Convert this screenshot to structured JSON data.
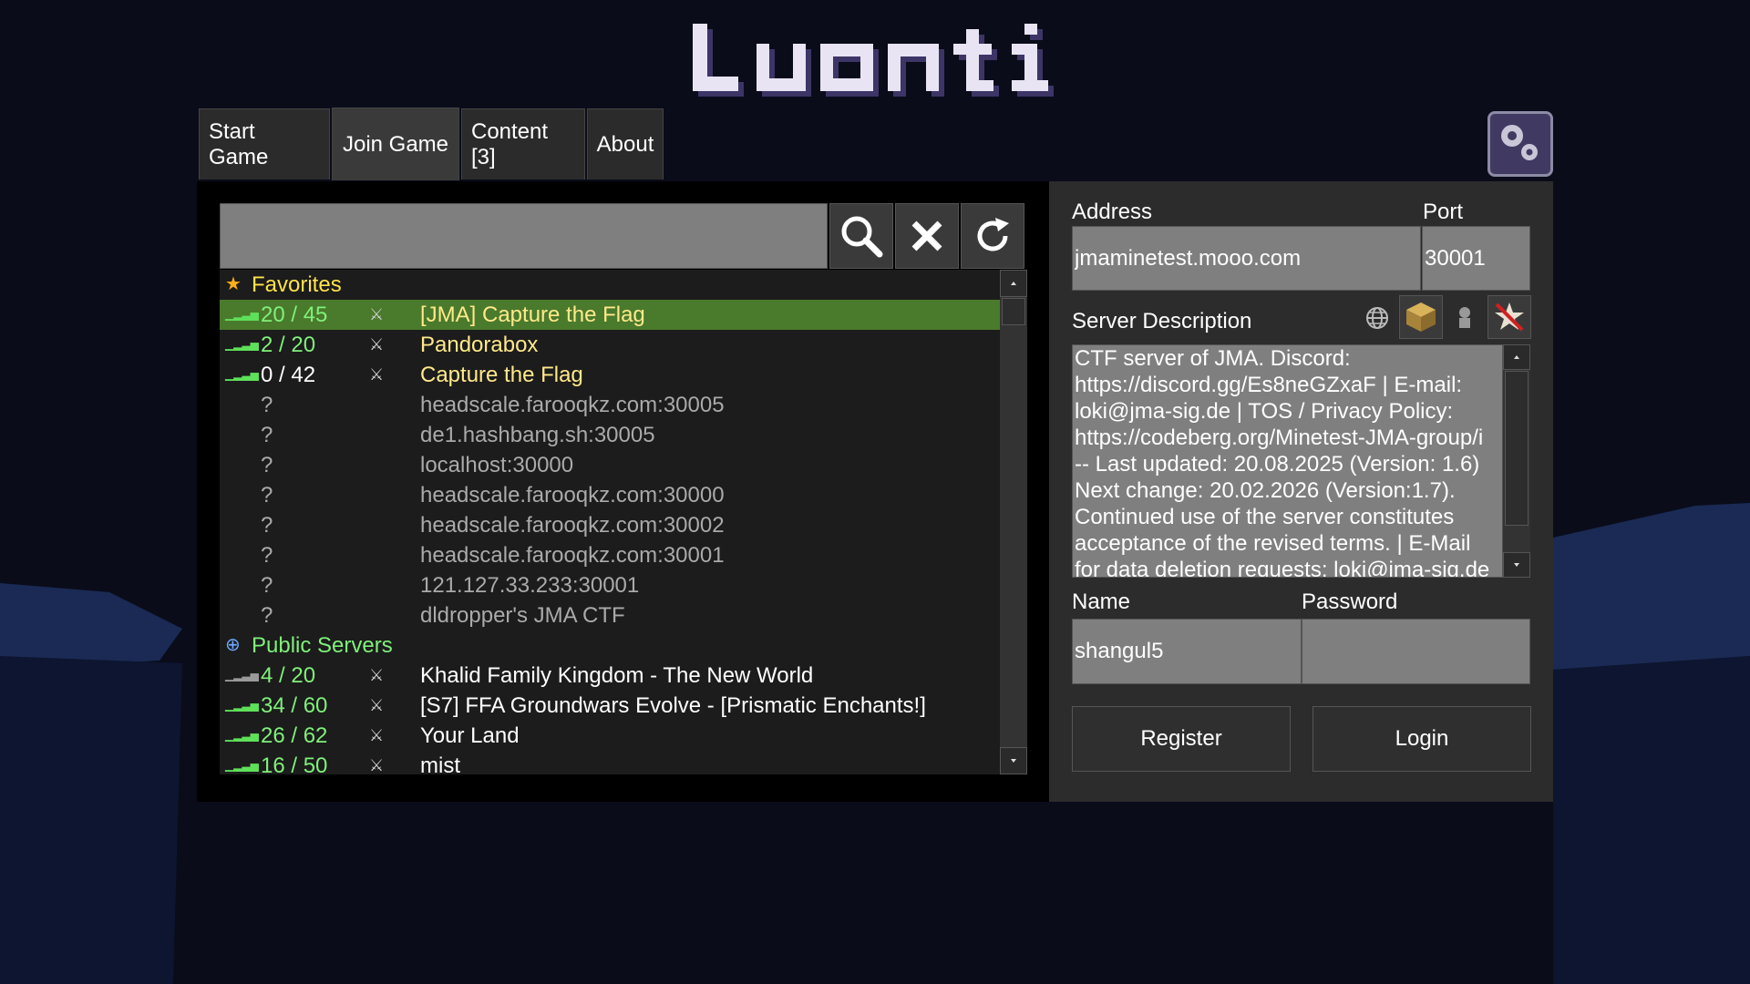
{
  "app": {
    "logo_text": "Luanti"
  },
  "tabs": [
    {
      "label": "Start Game"
    },
    {
      "label": "Join Game"
    },
    {
      "label": "Content [3]"
    },
    {
      "label": "About"
    }
  ],
  "search": {
    "value": "",
    "placeholder": ""
  },
  "favorites": {
    "header": "Favorites",
    "servers": [
      {
        "players": "20 / 45",
        "name": "[JMA] Capture the Flag",
        "selected": true
      },
      {
        "players": "2 / 20",
        "name": "Pandorabox"
      },
      {
        "players": "0 / 42",
        "name": "Capture the Flag"
      },
      {
        "players": "?",
        "name": "headscale.farooqkz.com:30005"
      },
      {
        "players": "?",
        "name": "de1.hashbang.sh:30005"
      },
      {
        "players": "?",
        "name": "localhost:30000"
      },
      {
        "players": "?",
        "name": "headscale.farooqkz.com:30000"
      },
      {
        "players": "?",
        "name": "headscale.farooqkz.com:30002"
      },
      {
        "players": "?",
        "name": "headscale.farooqkz.com:30001"
      },
      {
        "players": "?",
        "name": "121.127.33.233:30001"
      },
      {
        "players": "?",
        "name": "dldropper's JMA CTF"
      }
    ]
  },
  "public_servers": {
    "header": "Public Servers",
    "servers": [
      {
        "players": "4 / 20",
        "name": "Khalid Family Kingdom - The New World"
      },
      {
        "players": "34 / 60",
        "name": "[S7] FFA Groundwars Evolve - [Prismatic Enchants!]"
      },
      {
        "players": "26 / 62",
        "name": "Your Land"
      },
      {
        "players": "16 / 50",
        "name": "mist"
      }
    ]
  },
  "details": {
    "address_label": "Address",
    "address_value": "jmaminetest.mooo.com",
    "port_label": "Port",
    "port_value": "30001",
    "description_label": "Server Description",
    "description": "CTF server of JMA. Discord:\nhttps://discord.gg/Es8neGZxaF | E-mail:\nloki@jma-sig.de | TOS / Privacy Policy:\nhttps://codeberg.org/Minetest-JMA-group/i\n-- Last updated: 20.08.2025 (Version: 1.6)\nNext change: 20.02.2026 (Version:1.7).\nContinued use of the server constitutes\nacceptance of the revised terms. |  E-Mail\nfor data deletion requests: loki@jma-sig.de",
    "name_label": "Name",
    "name_value": "shangul5",
    "password_label": "Password",
    "password_value": "",
    "register_label": "Register",
    "login_label": "Login"
  }
}
